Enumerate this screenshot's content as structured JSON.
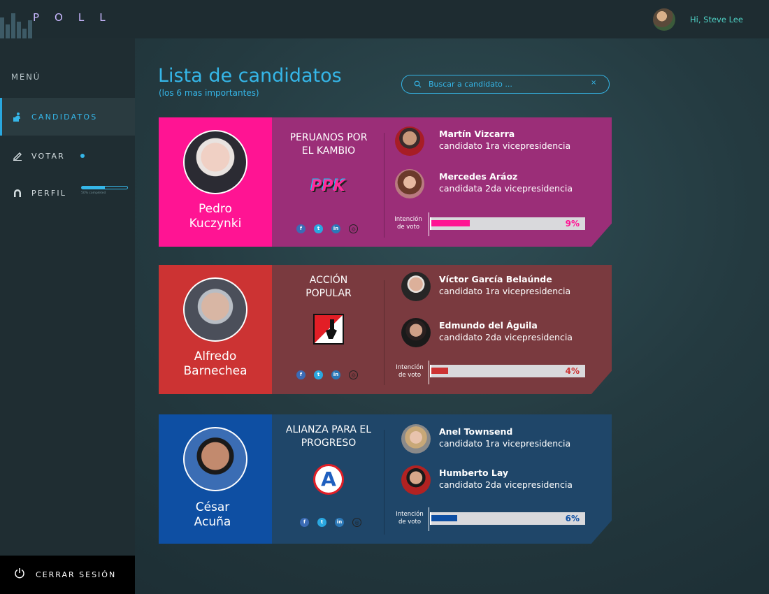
{
  "app": {
    "logo": "POLL",
    "greeting": "Hi, Steve Lee"
  },
  "sidebar": {
    "menu_title": "MENÚ",
    "items": [
      {
        "label": "CANDIDATOS",
        "icon": "candidates-icon",
        "active": true
      },
      {
        "label": "VOTAR",
        "icon": "vote-icon",
        "active": false
      },
      {
        "label": "PERFIL",
        "icon": "profile-icon",
        "active": false
      }
    ],
    "profile_progress": 0.5,
    "profile_caption": "50% completed",
    "logout_label": "CERRAR SESIÓN"
  },
  "header": {
    "title": "Lista de candidatos",
    "subtitle": "(los 6 mas importantes)",
    "search_placeholder": "Buscar a candidato ...",
    "search_clear": "×"
  },
  "vote_label_line1": "Intención",
  "vote_label_line2": "de voto",
  "candidates": [
    {
      "name_line1": "Pedro",
      "name_line2": "Kuczynki",
      "party_line1": "PERUANOS POR",
      "party_line2": "EL KAMBIO",
      "party_logo_text": "PPK",
      "vp1_name": "Martín Vizcarra",
      "vp1_role": "candidato 1ra vicepresidencia",
      "vp2_name": "Mercedes Aráoz",
      "vp2_role": "candidata 2da vicepresidencia",
      "vote_percent": 9,
      "vote_text": "9%",
      "left_color": "#ff1493",
      "right_color": "#9b2e78",
      "accent": "#ff1493"
    },
    {
      "name_line1": "Alfredo",
      "name_line2": "Barnechea",
      "party_line1": "ACCIÓN",
      "party_line2": "POPULAR",
      "vp1_name": "Víctor García Belaúnde",
      "vp1_role": "candidato 1ra vicepresidencia",
      "vp2_name": "Edmundo del Águila",
      "vp2_role": "candidato 2da vicepresidencia",
      "vote_percent": 4,
      "vote_text": "4%",
      "left_color": "#cc3333",
      "right_color": "#7a3a3f",
      "accent": "#cc3333"
    },
    {
      "name_line1": "César",
      "name_line2": "Acuña",
      "party_line1": "ALIANZA PARA EL",
      "party_line2": "PROGRESO",
      "party_logo_text": "A",
      "vp1_name": "Anel Townsend",
      "vp1_role": "candidato 1ra vicepresidencia",
      "vp2_name": "Humberto Lay",
      "vp2_role": "candidato 2da vicepresidencia",
      "vote_percent": 6,
      "vote_text": "6%",
      "left_color": "#0e4fa3",
      "right_color": "#1f4669",
      "accent": "#0e4fa3"
    }
  ]
}
